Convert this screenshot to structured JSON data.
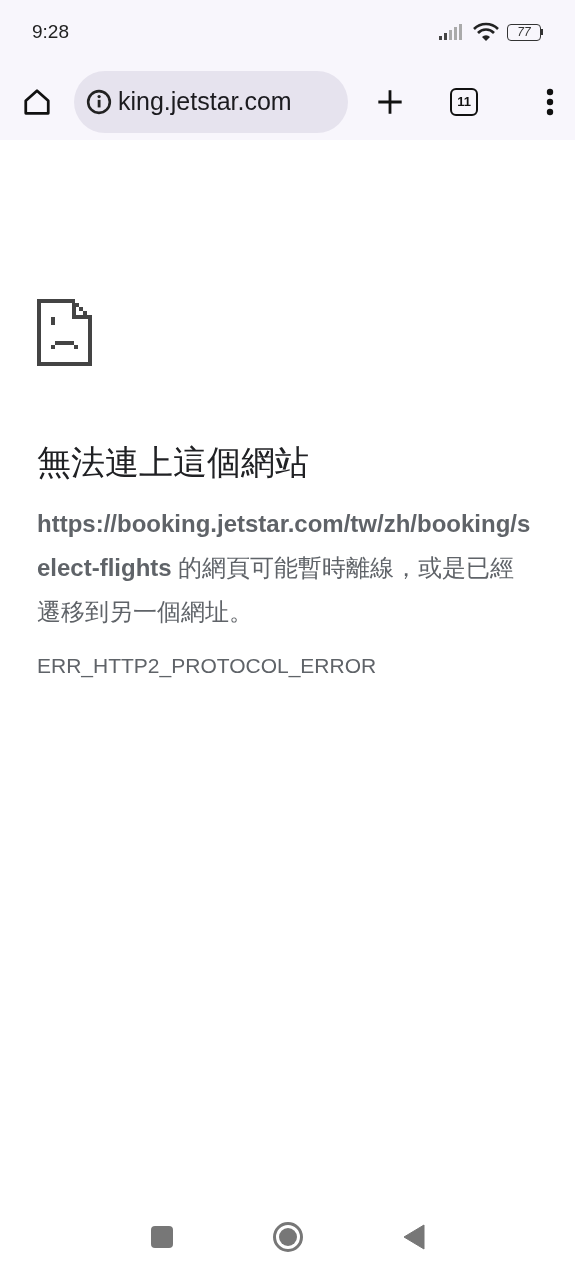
{
  "status_bar": {
    "time": "9:28",
    "battery": "77"
  },
  "toolbar": {
    "url": "king.jetstar.com",
    "tab_count": "11"
  },
  "error": {
    "title": "無法連上這個網站",
    "message": "**https://booking.jetstar.com/tw/zh/booking/select-flights** 的網頁可能暫時離線，或是已經遷移到另一個網址。",
    "code": "ERR_HTTP2_PROTOCOL_ERROR"
  }
}
